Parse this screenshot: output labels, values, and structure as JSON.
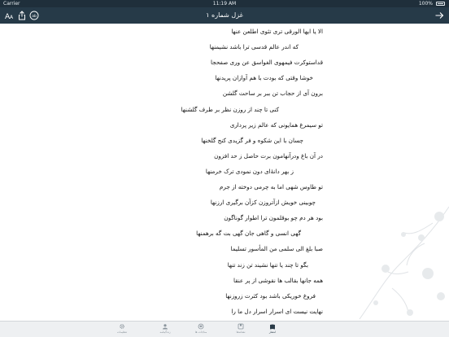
{
  "status_bar": {
    "carrier": "Carrier",
    "time": "11:19 AM",
    "battery": "100%"
  },
  "nav": {
    "title": "غزل شماره ۱",
    "font_badge": "ab"
  },
  "verses": [
    "الا یا ایها الورقی تری تئوی اطلعن عنها",
    "که اندر عالم قدسی ترا باشد نشیمنها",
    "قداستوکرت فیمهوی الغواسق عن وری صفحجا",
    "خوشا وقتی که بودت با هم آوازان پریدنها",
    "برون آی از حجاب تن ببر بر ساحت گلشن",
    "کنی تا چند از روزن نظر بر طرف گلشنها",
    "تو سیمرغ همایونی که عالم زیر پرداری",
    "چسان با این شکوه و فر گزیدی کنج گلخنها",
    "در آن باغ ودرآنهامون برت حاصل ز حد افزون",
    "ز بهر دانهٔ‌ای دون نمودی ترک خرمنها",
    "تو طاوس شهی اما به چرمی دوخته از جرم",
    "چوبینی خویش ازآتروزن کزآن برگیری ارزنها",
    "بود هر دم چو بوقلمون ترا اطوار گوناگون",
    "گهی انسی و گاهی جان گهی بت گه برهمنها",
    "صبا بلغ الی سلمی من المأسور تسلیما",
    "بگو تا چند یا تنها نشیند تن زند تنها",
    "همه جانها بقالب ها نقوشی از پر عنقا",
    "فروغ خوریکی باشد بود کثرت زروزنها",
    "نهایت نیست ای اسرار اسرار دل ما را"
  ],
  "tabs": [
    {
      "label": "اشعار",
      "icon": "book-icon",
      "active": true
    },
    {
      "label": "نشانه‌ها",
      "icon": "bookmark-icon",
      "active": false
    },
    {
      "label": "مناجات ها",
      "icon": "heart-icon",
      "active": false
    },
    {
      "label": "زندگینامه",
      "icon": "user-icon",
      "active": false
    },
    {
      "label": "تنظیمات",
      "icon": "gear-icon",
      "active": false
    }
  ],
  "colors": {
    "status_bar": "#1f2f3b",
    "nav_bar": "#263a48",
    "tab_active": "#2a3b48",
    "tab_inactive": "#8a949c"
  }
}
